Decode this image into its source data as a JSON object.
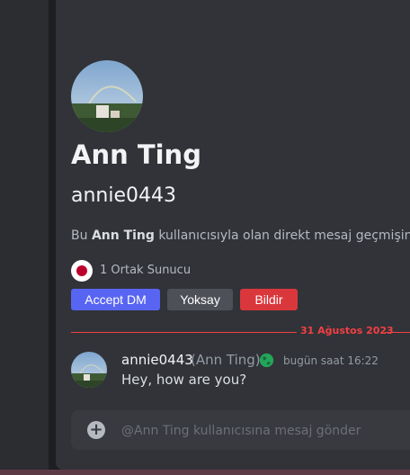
{
  "profile": {
    "display_name": "Ann Ting",
    "username": "annie0443",
    "history_prefix": "Bu ",
    "history_name": "Ann Ting",
    "history_suffix": " kullanıcısıyla olan direkt mesaj geçmişinin b",
    "mutual_servers": "1 Ortak Sunucu"
  },
  "actions": {
    "accept": "Accept DM",
    "ignore": "Yoksay",
    "report": "Bildir"
  },
  "divider": {
    "date": "31 Ağustos 2023"
  },
  "message": {
    "author": "annie0443",
    "real_name": "(Ann Ting)",
    "timestamp": "bugün saat 16:22",
    "text": "Hey, how are you?"
  },
  "composer": {
    "placeholder": "@Ann Ting kullanıcısına mesaj gönder"
  },
  "colors": {
    "accent": "#5865f2",
    "danger": "#da373c",
    "secondary": "#4e5058",
    "divider": "#f23f43"
  }
}
